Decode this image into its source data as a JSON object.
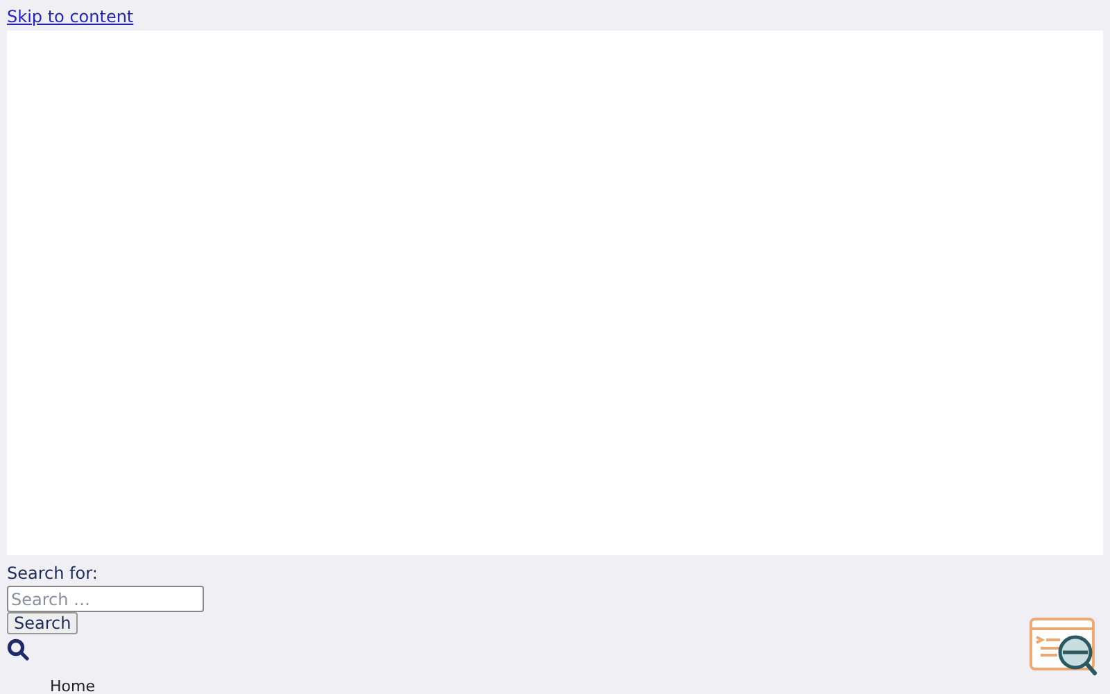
{
  "skip_link": "Skip to content",
  "search": {
    "label": "Search for:",
    "placeholder": "Search …",
    "button": "Search"
  },
  "nav": [
    {
      "label": "Home"
    }
  ]
}
